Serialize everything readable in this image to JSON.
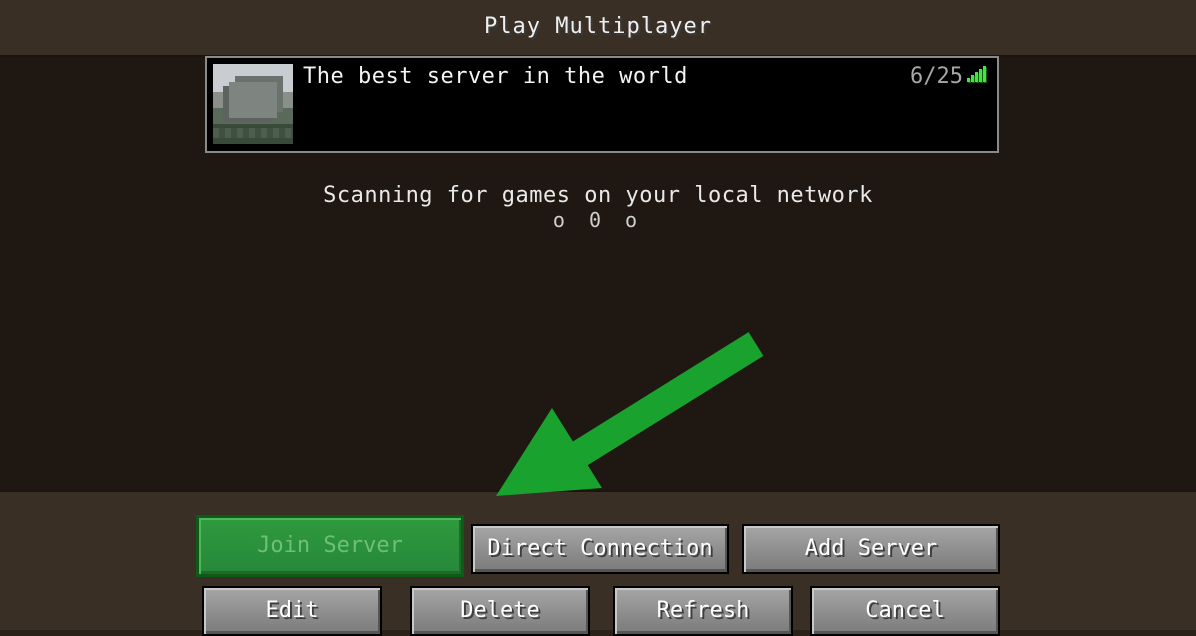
{
  "header": {
    "title": "Play Multiplayer"
  },
  "server_list": {
    "entries": [
      {
        "name": "The best server in the world",
        "players": "6/25"
      }
    ]
  },
  "status": {
    "scanning": "Scanning for games on your local network",
    "loading": "o 0 o"
  },
  "buttons": {
    "join": "Join Server",
    "direct": "Direct Connection",
    "add": "Add Server",
    "edit": "Edit",
    "delete": "Delete",
    "refresh": "Refresh",
    "cancel": "Cancel"
  },
  "colors": {
    "arrow": "#1aa22e",
    "signal": "#3ee83e",
    "join_button": "#2f9a3d"
  }
}
